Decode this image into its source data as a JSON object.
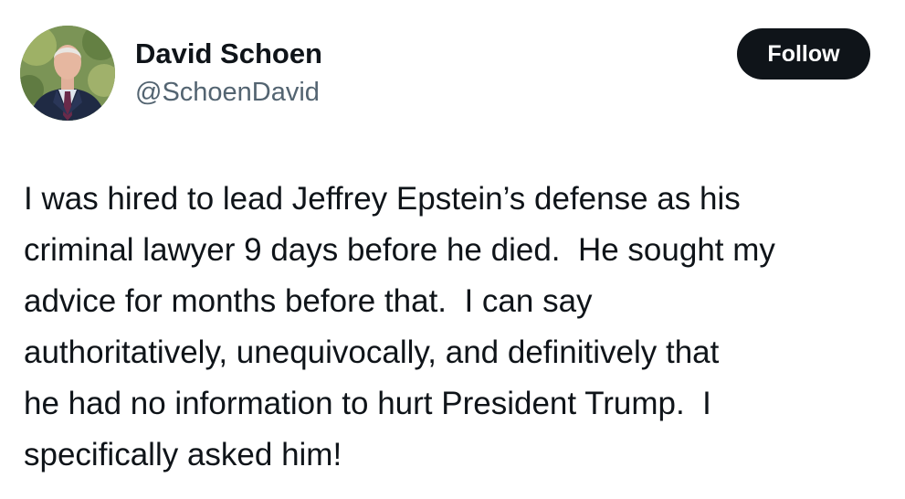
{
  "author": {
    "display_name": "David Schoen",
    "handle": "@SchoenDavid",
    "avatar_icon": "profile-photo-man-in-suit"
  },
  "actions": {
    "follow_label": "Follow"
  },
  "tweet": {
    "lines": [
      "I was hired to lead Jeffrey Epstein’s defense as his",
      "criminal lawyer 9 days before he died.  He sought my",
      "advice for months before that.  I can say",
      "authoritatively, unequivocally, and definitively that",
      "he had no information to hurt President Trump.  I",
      "specifically asked him!"
    ]
  },
  "colors": {
    "text_primary": "#0f1419",
    "text_secondary": "#536471",
    "button_bg": "#0f1419",
    "button_text": "#ffffff"
  }
}
